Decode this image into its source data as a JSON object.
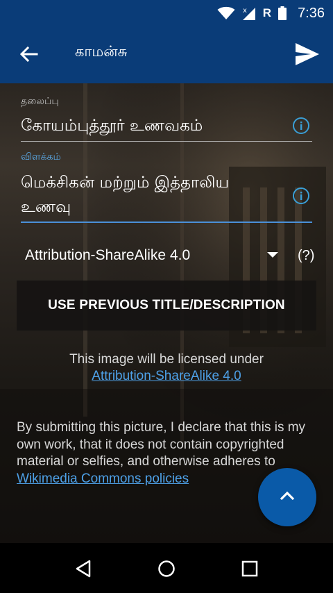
{
  "status_bar": {
    "time": "7:36",
    "roaming_label": "R",
    "icons": [
      "wifi-icon",
      "signal-icon",
      "battery-icon"
    ]
  },
  "app_bar": {
    "title": "காமன்சு",
    "back_icon": "arrow-back-icon",
    "send_icon": "send-icon",
    "color": "#0a3c78"
  },
  "form": {
    "title_field": {
      "label": "தலைப்பு",
      "value": "கோயம்புத்தூர் உணவகம்"
    },
    "description_field": {
      "label": "விளக்கம்",
      "value_line1": "மெக்சிகன் மற்றும் இத்தாலிய",
      "value_line2": "உணவு"
    },
    "license": {
      "selected": "Attribution-ShareAlike 4.0",
      "help_label": "(?)"
    },
    "previous_button_label": "USE PREVIOUS TITLE/DESCRIPTION",
    "license_note": "This image will be licensed under",
    "license_link": "Attribution-ShareAlike 4.0",
    "declaration_text": "By submitting this picture, I declare that this is my own work, that it does not contain copyrighted material or selfies, and otherwise adheres to ",
    "declaration_link": "Wikimedia Commons policies"
  },
  "fab_icon": "chevron-up-icon",
  "nav_bar": {
    "icons": [
      "nav-back-icon",
      "nav-home-icon",
      "nav-recents-icon"
    ]
  },
  "colors": {
    "accent": "#4a90d9",
    "link": "#4ea1e8",
    "fab": "#0a5aa8"
  }
}
